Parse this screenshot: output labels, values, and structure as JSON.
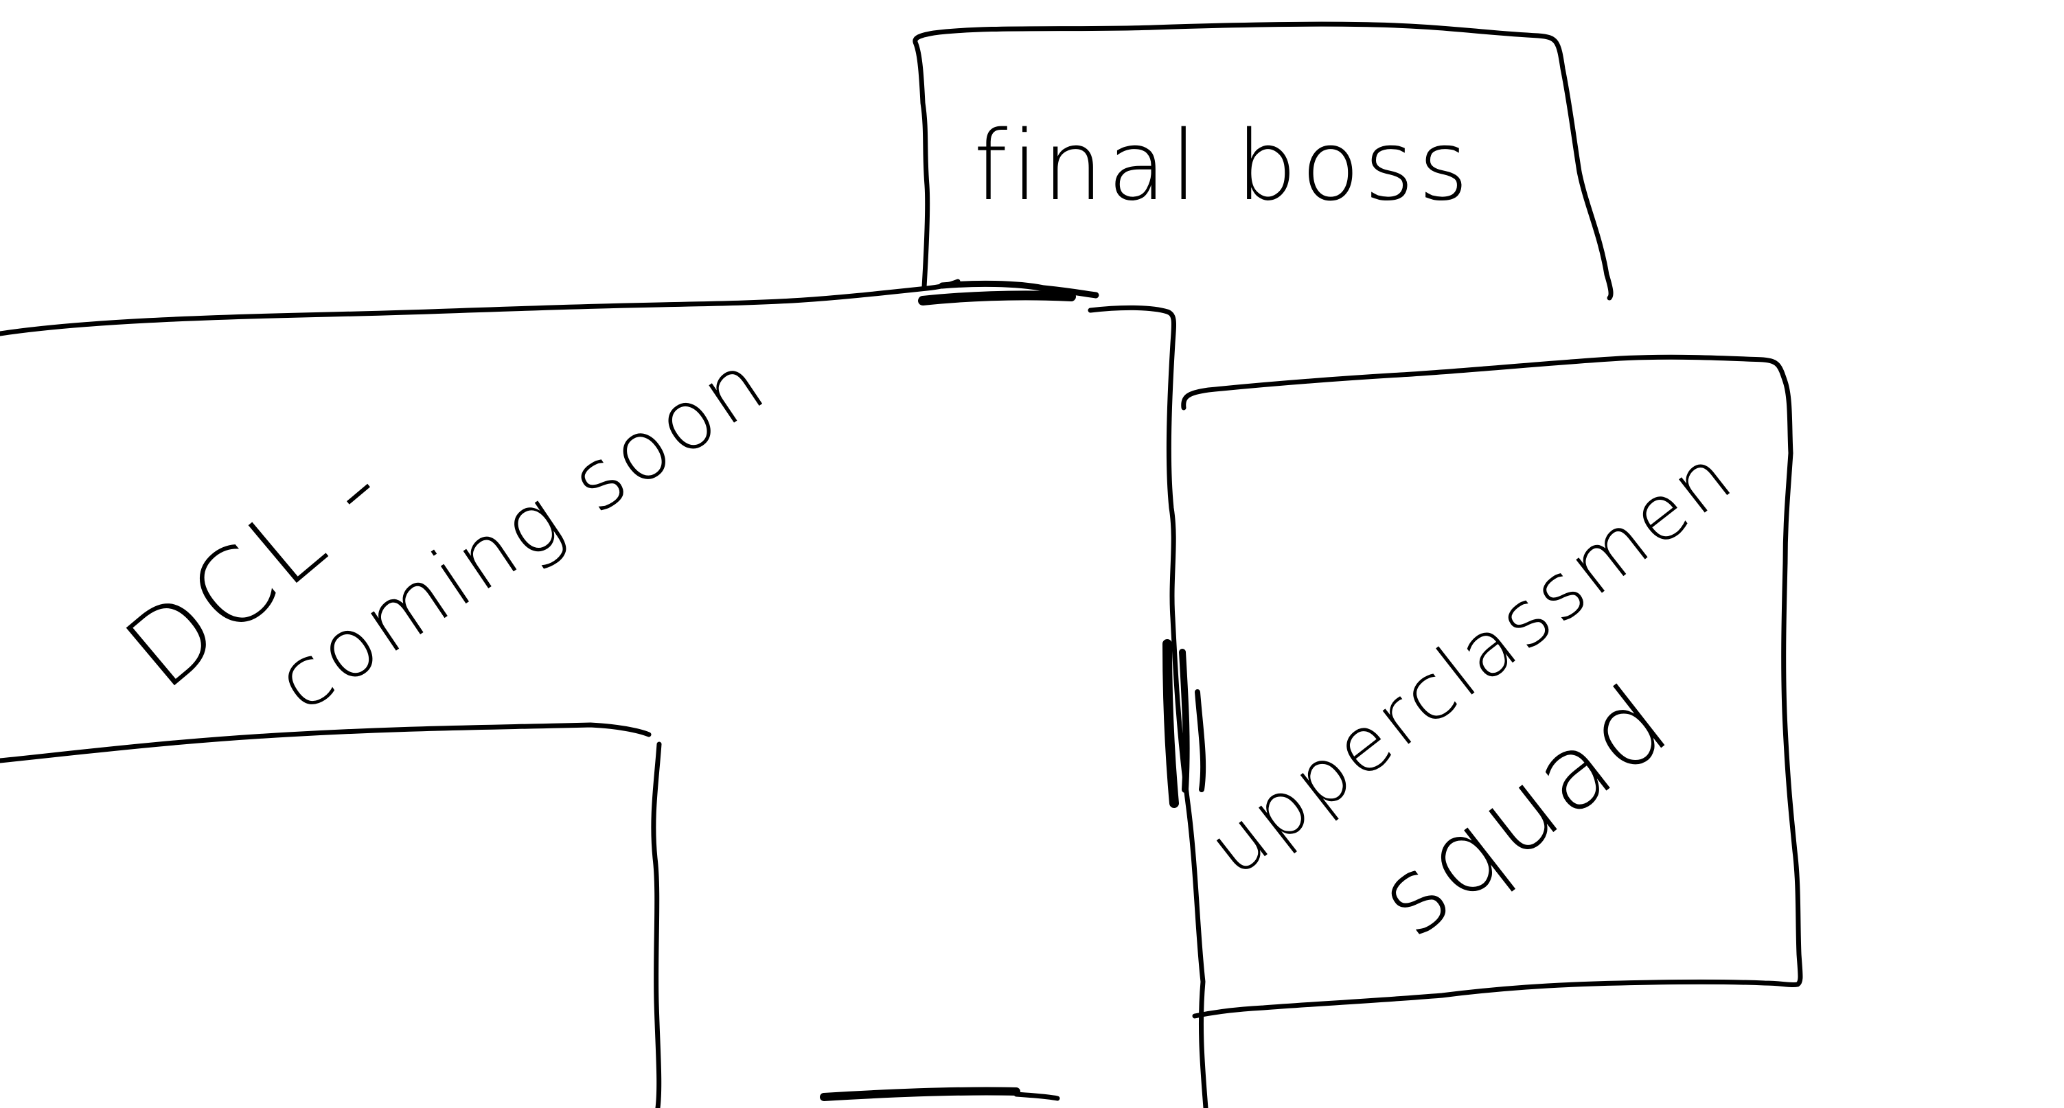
{
  "diagram": {
    "ink_color": "#000000",
    "background_color": "#ffffff",
    "rooms": [
      {
        "id": "final-boss",
        "label": "final boss"
      },
      {
        "id": "dlc",
        "label_lines": [
          "DCL -",
          "coming soon"
        ]
      },
      {
        "id": "upperclassmen",
        "label_lines": [
          "upperclassmen",
          "squad"
        ]
      }
    ],
    "doors": [
      {
        "id": "door-final-boss"
      },
      {
        "id": "door-upperclassmen"
      },
      {
        "id": "door-bottom"
      }
    ]
  }
}
